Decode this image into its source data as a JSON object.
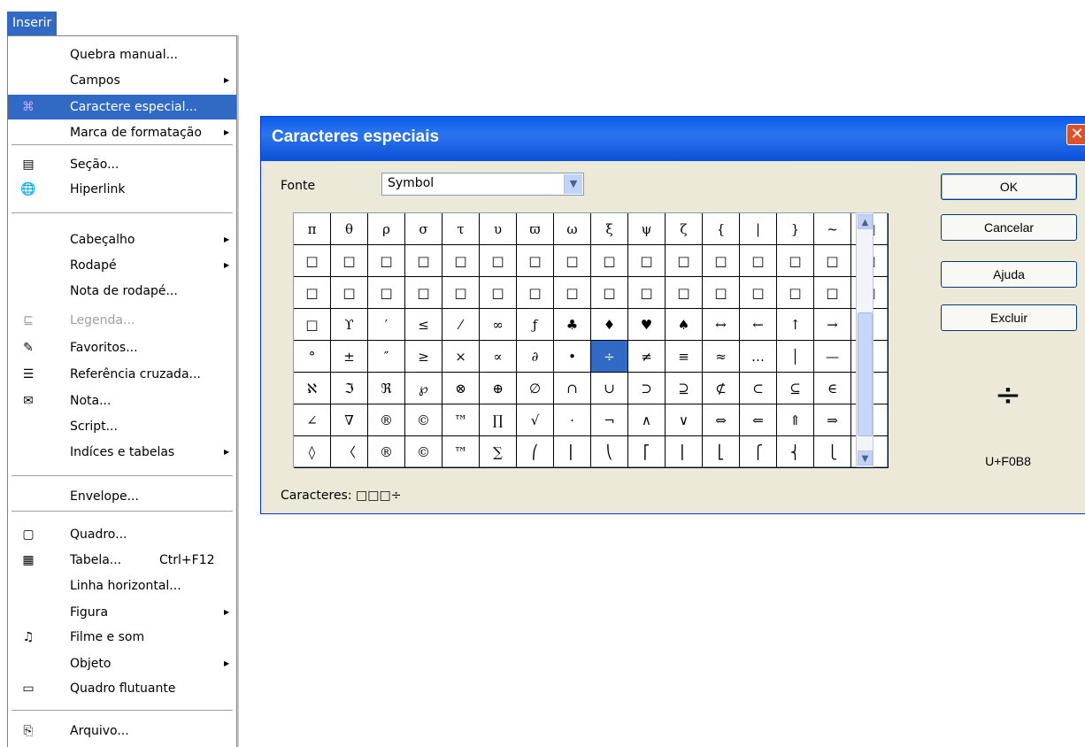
{
  "menubar": {
    "active_menu": "Inserir"
  },
  "menu": {
    "items": [
      {
        "label": "Quebra manual...",
        "icon": "",
        "submenu": false
      },
      {
        "label": "Campos",
        "icon": "",
        "submenu": true
      },
      {
        "label": "Caractere especial...",
        "icon": "special-character-icon",
        "submenu": false,
        "highlighted": true
      },
      {
        "label": "Marca de formatação",
        "icon": "",
        "submenu": true
      },
      {
        "label": "Seção...",
        "icon": "section-icon",
        "submenu": false
      },
      {
        "label": "Hiperlink",
        "icon": "hyperlink-globe-icon",
        "submenu": false
      },
      {
        "label": "Cabeçalho",
        "icon": "",
        "submenu": true
      },
      {
        "label": "Rodapé",
        "icon": "",
        "submenu": true
      },
      {
        "label": "Nota de rodapé...",
        "icon": "",
        "submenu": false
      },
      {
        "label": "Legenda...",
        "icon": "caption-icon",
        "submenu": false,
        "disabled": true
      },
      {
        "label": "Favoritos...",
        "icon": "bookmark-pin-icon",
        "submenu": false
      },
      {
        "label": "Referência cruzada...",
        "icon": "cross-reference-icon",
        "submenu": false
      },
      {
        "label": "Nota...",
        "icon": "note-icon",
        "submenu": false
      },
      {
        "label": "Script...",
        "icon": "",
        "submenu": false
      },
      {
        "label": "Indíces e tabelas",
        "icon": "",
        "submenu": true
      },
      {
        "label": "Envelope...",
        "icon": "",
        "submenu": false
      },
      {
        "label": "Quadro...",
        "icon": "frame-icon",
        "submenu": false
      },
      {
        "label": "Tabela...",
        "accel": "Ctrl+F12",
        "icon": "table-icon",
        "submenu": false
      },
      {
        "label": "Linha horizontal...",
        "icon": "",
        "submenu": false
      },
      {
        "label": "Figura",
        "icon": "",
        "submenu": true
      },
      {
        "label": "Filme e som",
        "icon": "movie-sound-icon",
        "submenu": false
      },
      {
        "label": "Objeto",
        "icon": "",
        "submenu": true
      },
      {
        "label": "Quadro flutuante",
        "icon": "floating-frame-icon",
        "submenu": false
      },
      {
        "label": "Arquivo...",
        "icon": "file-insert-icon",
        "submenu": false
      }
    ]
  },
  "dialog": {
    "title": "Caracteres especiais",
    "font_label": "Fonte",
    "font_value": "Symbol",
    "buttons": {
      "ok": "OK",
      "cancel": "Cancelar",
      "help": "Ajuda",
      "delete": "Excluir"
    },
    "preview_char": "÷",
    "preview_code": "U+F0B8",
    "characters_label": "Caracteres:",
    "characters_value": "□□□÷",
    "grid": [
      [
        "π",
        "θ",
        "ρ",
        "σ",
        "τ",
        "υ",
        "ϖ",
        "ω",
        "ξ",
        "ψ",
        "ζ",
        "{",
        "|",
        "}",
        "~",
        "□"
      ],
      [
        "□",
        "□",
        "□",
        "□",
        "□",
        "□",
        "□",
        "□",
        "□",
        "□",
        "□",
        "□",
        "□",
        "□",
        "□",
        "□"
      ],
      [
        "□",
        "□",
        "□",
        "□",
        "□",
        "□",
        "□",
        "□",
        "□",
        "□",
        "□",
        "□",
        "□",
        "□",
        "□",
        "□"
      ],
      [
        "□",
        "ϒ",
        "′",
        "≤",
        "⁄",
        "∞",
        "ƒ",
        "♣",
        "♦",
        "♥",
        "♠",
        "↔",
        "←",
        "↑",
        "→",
        "↓"
      ],
      [
        "°",
        "±",
        "″",
        "≥",
        "×",
        "∝",
        "∂",
        "•",
        "÷",
        "≠",
        "≡",
        "≈",
        "…",
        "│",
        "—",
        "↵"
      ],
      [
        "ℵ",
        "ℑ",
        "ℜ",
        "℘",
        "⊗",
        "⊕",
        "∅",
        "∩",
        "∪",
        "⊃",
        "⊇",
        "⊄",
        "⊂",
        "⊆",
        "∈",
        "∉"
      ],
      [
        "∠",
        "∇",
        "®",
        "©",
        "™",
        "∏",
        "√",
        "·",
        "¬",
        "∧",
        "∨",
        "⇔",
        "⇐",
        "⇑",
        "⇒",
        "⇓"
      ],
      [
        "◊",
        "〈",
        "®",
        "©",
        "™",
        "∑",
        "⎛",
        "⎜",
        "⎝",
        "⎡",
        "⎢",
        "⎣",
        "⎧",
        "⎨",
        "⎩",
        "⎪"
      ]
    ],
    "selected": {
      "row": 4,
      "col": 8
    }
  }
}
